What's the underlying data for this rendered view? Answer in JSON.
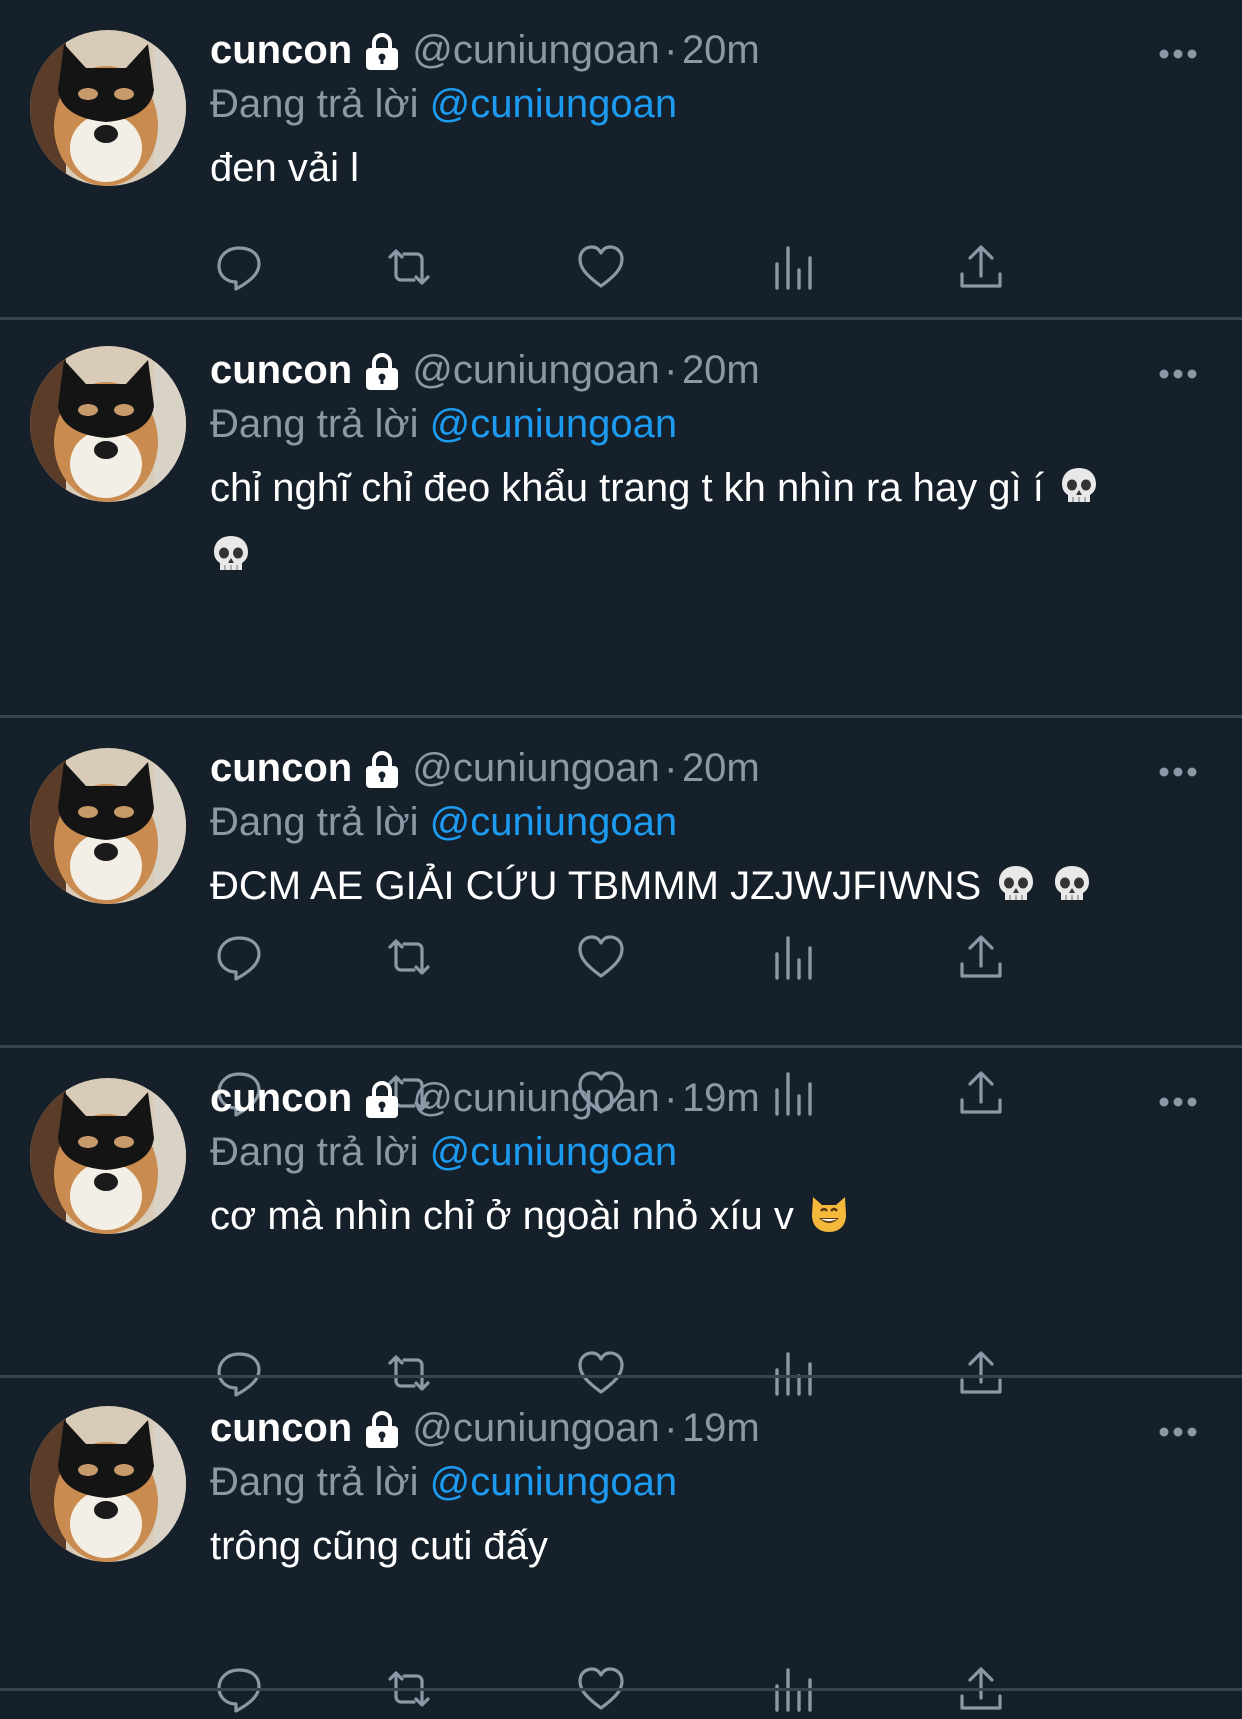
{
  "tweets": [
    {
      "name": "cuncon",
      "handle": "@cuniungoan",
      "dot": "·",
      "time": "20m",
      "replying_prefix": "Đang trả lời",
      "replying_to": "@cuniungoan",
      "text": "đen vải l",
      "text2": "",
      "emoji_inline": [],
      "emoji_line2": []
    },
    {
      "name": "cuncon",
      "handle": "@cuniungoan",
      "dot": "·",
      "time": "20m",
      "replying_prefix": "Đang trả lời",
      "replying_to": "@cuniungoan",
      "text": "chỉ nghĩ chỉ đeo khẩu trang t kh nhìn ra hay gì í",
      "text2": "",
      "emoji_inline": [
        "skull"
      ],
      "emoji_line2": [
        "skull"
      ]
    },
    {
      "name": "cuncon",
      "handle": "@cuniungoan",
      "dot": "·",
      "time": "20m",
      "replying_prefix": "Đang trả lời",
      "replying_to": "@cuniungoan",
      "text": "ĐCM AE GIẢI CỨU TBMMM JZJWJFIWNS",
      "text2": "",
      "emoji_inline": [
        "skull",
        "skull"
      ],
      "emoji_line2": []
    },
    {
      "name": "cuncon",
      "handle": "@cuniungoan",
      "dot": "·",
      "time": "19m",
      "replying_prefix": "Đang trả lời",
      "replying_to": "@cuniungoan",
      "text": "cơ mà nhìn chỉ ở ngoài nhỏ xíu v",
      "text2": "",
      "emoji_inline": [
        "smiling-cat"
      ],
      "emoji_line2": []
    },
    {
      "name": "cuncon",
      "handle": "@cuniungoan",
      "dot": "·",
      "time": "19m",
      "replying_prefix": "Đang trả lời",
      "replying_to": "@cuniungoan",
      "text": "trông cũng cuti đấy",
      "text2": "",
      "emoji_inline": [],
      "emoji_line2": []
    }
  ],
  "icons": {
    "lock": "lock-icon",
    "more": "more-icon",
    "reply": "reply-icon",
    "retweet": "retweet-icon",
    "like": "heart-icon",
    "views": "views-icon",
    "share": "share-icon"
  },
  "colors": {
    "background": "#15202b",
    "secondary_text": "#8b98a5",
    "mention": "#1d9bf0",
    "separator": "#38444d"
  }
}
